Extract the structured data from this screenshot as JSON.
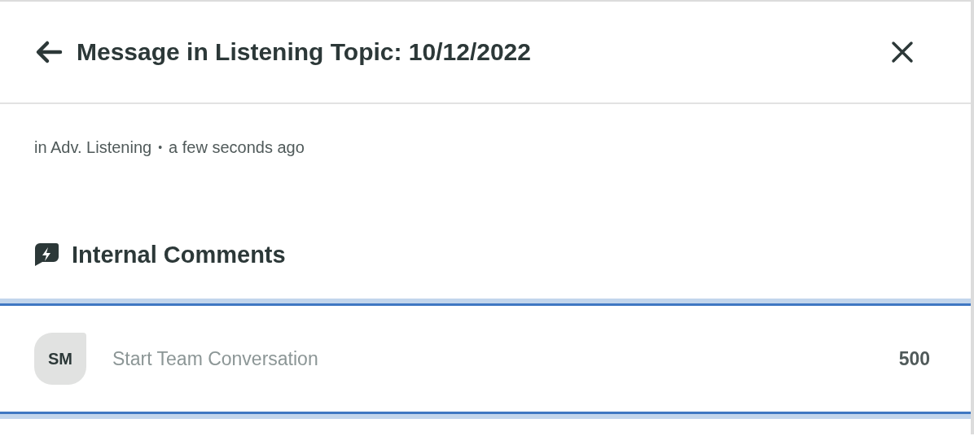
{
  "header": {
    "title": "Message in Listening Topic: 10/12/2022"
  },
  "meta": {
    "location": "in Adv. Listening",
    "separator": "•",
    "time": "a few seconds ago"
  },
  "section": {
    "title": "Internal Comments"
  },
  "composer": {
    "avatar": "SM",
    "placeholder": "Start Team Conversation",
    "counter": "500"
  }
}
